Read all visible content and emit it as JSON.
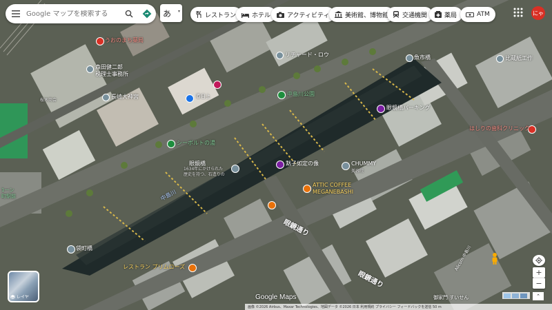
{
  "search": {
    "placeholder": "Google マップを検索する",
    "ime_label": "あ"
  },
  "categories": [
    {
      "label": "レストラン",
      "icon": "restaurant-icon"
    },
    {
      "label": "ホテル",
      "icon": "hotel-icon"
    },
    {
      "label": "アクティビティ",
      "icon": "camera-icon"
    },
    {
      "label": "美術館、博物館",
      "icon": "museum-icon"
    },
    {
      "label": "交通機関",
      "icon": "transit-icon"
    },
    {
      "label": "薬局",
      "icon": "pharmacy-icon"
    },
    {
      "label": "ATM",
      "icon": "atm-icon"
    }
  ],
  "account": {
    "avatar_text": "にゃ"
  },
  "places": {
    "uonomachi_pharmacy": "うおのまち薬局",
    "richard_lau": "リチャード・ロウ",
    "uoichi_bridge": "魚市橋",
    "hikari_clinic": "比蔵紙工作",
    "morita_office": "森田健二郎\n税理士事務所",
    "nagasaki_shrine": "長崎大神宮",
    "kasugami": "春日上",
    "sakura_shokai": "桜木商会",
    "nakashima_park": "中島川公園",
    "sunoji_bridge": "眼鏡橋パーキング",
    "hirano_clinic": "はしりの歯科クリニック",
    "siebold": "シーボルトの湯",
    "kaminoshima_bridge": "眼鏡橋",
    "bridge_history": "1634年にかけられた\n歴史を持つ、石造りの",
    "yu_monument": "黙子如定の像",
    "chummy": "CHUMMY",
    "chummy_sub": "美容院",
    "attic_coffee": "ATTIC COFFEE\nMEGANEBASHI",
    "nakashima_river": "中島川",
    "fukuromachi_bridge": "袋町橋",
    "restaurant_primrose": "レストラン プリムローズ",
    "kashima_street": "眼鏡通り",
    "kashima_street2": "眼鏡通り",
    "alicorn": "Alicorn 中島川",
    "miyaji": "御家門 すいせん",
    "left_station": "1一ン\n町駅前"
  },
  "attribution": {
    "logo": "Google Maps",
    "footer": "画像 ©2026 Airbus、Maxar Technologies、地図データ ©2026   日本   利用規約   プライバシー   フィードバックを送信   50 m"
  },
  "map_controls": {
    "layers_label": "レイヤ",
    "zoom_in": "+",
    "zoom_out": "−"
  },
  "colors": {
    "accent": "#d93025",
    "poi_green": "#1e8e3e",
    "poi_purple": "#7b1fa2",
    "poi_orange": "#e8710a",
    "poi_blue": "#1a73e8"
  }
}
